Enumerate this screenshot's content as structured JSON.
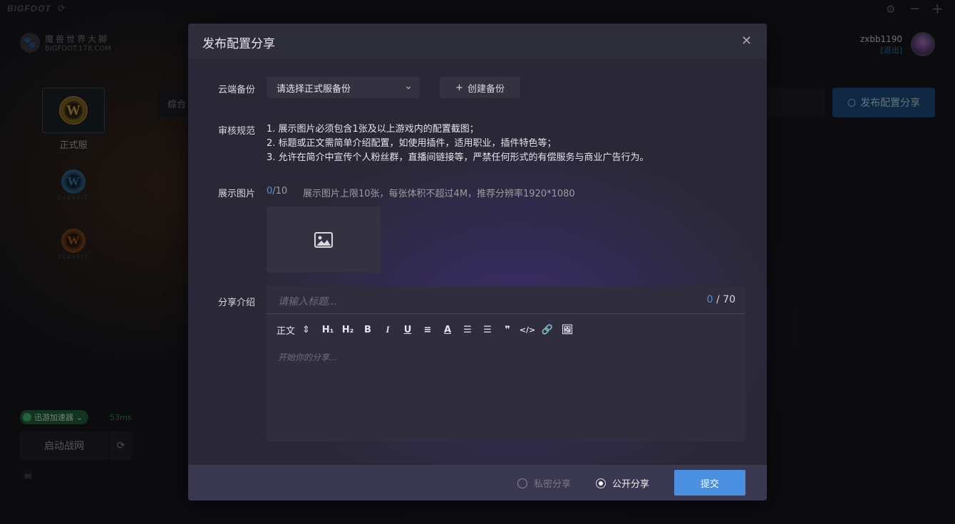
{
  "app": {
    "brand": "BIGFOOT",
    "logo_cn": "魔兽世界大脚",
    "logo_en": "BIGFOOT.178.COM"
  },
  "sidebar": {
    "games": [
      {
        "label": "正式服",
        "sub": ""
      },
      {
        "label": "",
        "sub": "CLASSIC"
      },
      {
        "label": "",
        "sub": "CLASSIC"
      }
    ],
    "accelerator_label": "迅游加速器",
    "ping": "53ms",
    "launch_label": "启动战网"
  },
  "user": {
    "name": "zxbb1190",
    "logout": "[退出]"
  },
  "main": {
    "filter_label": "综合",
    "publish_label": "发布配置分享"
  },
  "modal": {
    "title": "发布配置分享",
    "cloud_backup_label": "云端备份",
    "cloud_backup_value": "请选择正式服备份",
    "create_backup_label": "创建备份",
    "rules_label": "审核规范",
    "rules": [
      "1. 展示图片必须包含1张及以上游戏内的配置截图；",
      "2. 标题或正文需简单介绍配置，如使用插件，适用职业，插件特色等；",
      "3. 允许在简介中宣传个人粉丝群，直播间链接等，严禁任何形式的有偿服务与商业广告行为。"
    ],
    "images_label": "展示图片",
    "images_current": "0",
    "images_max": "/10",
    "images_hint": "展示图片上限10张，每张体积不超过4M，推荐分辨率1920*1080",
    "intro_label": "分享介绍",
    "title_placeholder": "请输入标题...",
    "title_count_current": "0",
    "title_count_max": " / 70",
    "toolbar_heading": "正文",
    "editor_placeholder": "开始你的分享...",
    "private_label": "私密分享",
    "public_label": "公开分享",
    "submit_label": "提交"
  }
}
